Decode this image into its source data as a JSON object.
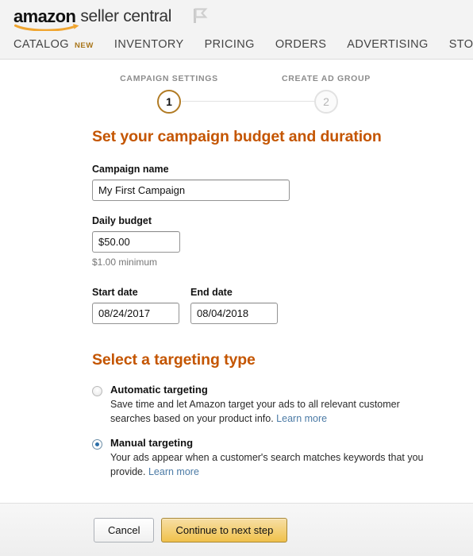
{
  "header": {
    "logo_amazon": "amazon",
    "logo_seller": "seller central",
    "flag_icon": "flag-icon",
    "nav": [
      {
        "label": "CATALOG",
        "badge": "NEW"
      },
      {
        "label": "INVENTORY",
        "badge": ""
      },
      {
        "label": "PRICING",
        "badge": ""
      },
      {
        "label": "ORDERS",
        "badge": ""
      },
      {
        "label": "ADVERTISING",
        "badge": ""
      },
      {
        "label": "STOREFRONT",
        "badge": ""
      }
    ]
  },
  "stepper": {
    "steps": [
      {
        "label": "CAMPAIGN SETTINGS",
        "number": "1",
        "state": "active"
      },
      {
        "label": "CREATE AD GROUP",
        "number": "2",
        "state": "inactive"
      }
    ]
  },
  "budget_section": {
    "title": "Set your campaign budget and duration",
    "campaign_name": {
      "label": "Campaign name",
      "value": "My First Campaign",
      "placeholder": ""
    },
    "daily_budget": {
      "label": "Daily budget",
      "value": "$50.00",
      "placeholder": "",
      "hint": "$1.00 minimum"
    },
    "start_date": {
      "label": "Start date",
      "value": "08/24/2017",
      "placeholder": ""
    },
    "end_date": {
      "label": "End date",
      "value": "08/04/2018",
      "placeholder": ""
    }
  },
  "targeting_section": {
    "title": "Select a targeting type",
    "options": [
      {
        "title": "Automatic targeting",
        "description": "Save time and let Amazon target your ads to all relevant customer searches based on your product info.",
        "link": "Learn more",
        "selected": false
      },
      {
        "title": "Manual targeting",
        "description": "Your ads appear when a customer's search matches keywords that you provide.",
        "link": "Learn more",
        "selected": true
      }
    ]
  },
  "footer": {
    "cancel_label": "Cancel",
    "continue_label": "Continue to next step"
  },
  "colors": {
    "accent_orange": "#c45500",
    "step_active": "#b17b24",
    "link_blue": "#4c7ba6",
    "primary_button": "#f0c14b",
    "badge_new": "#a8751a"
  }
}
